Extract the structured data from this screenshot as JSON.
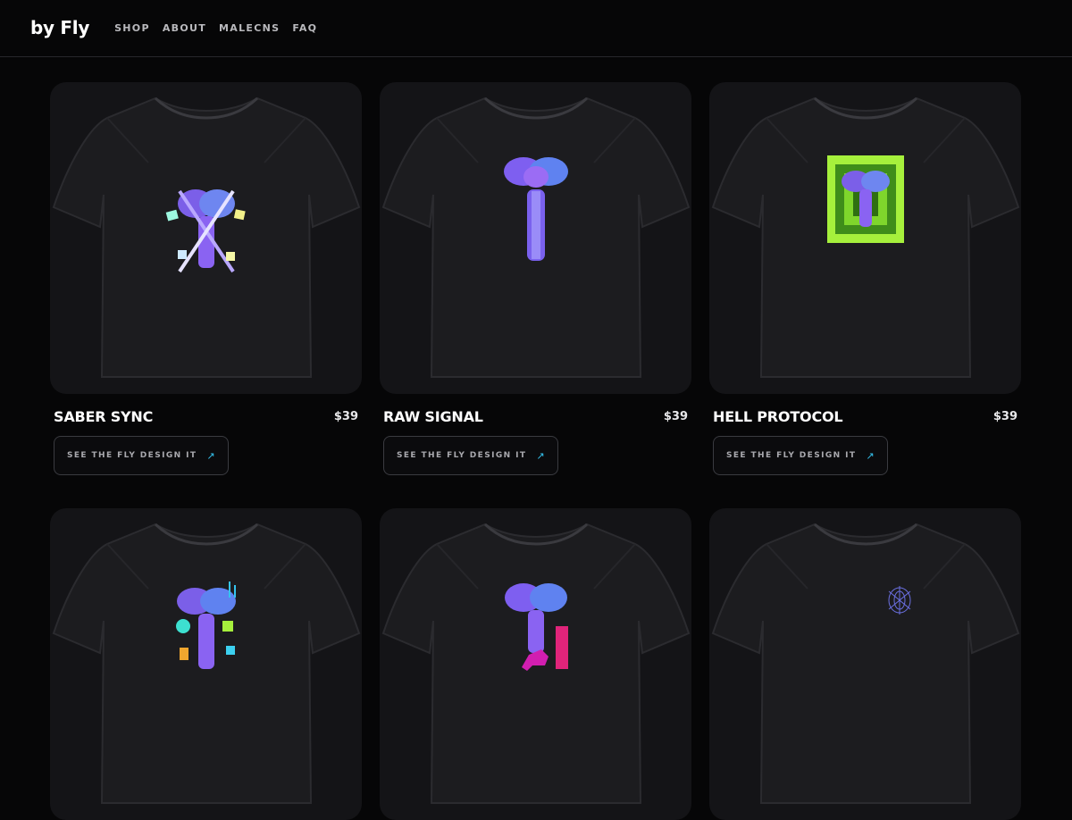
{
  "header": {
    "brand": "by Fly",
    "nav": [
      "SHOP",
      "ABOUT",
      "MALECNS",
      "FAQ"
    ]
  },
  "products": [
    {
      "name": "SABER SYNC",
      "price": "$39",
      "button": "SEE THE FLY DESIGN IT",
      "art": "brain-crossed-sabers"
    },
    {
      "name": "RAW SIGNAL",
      "price": "$39",
      "button": "SEE THE FLY DESIGN IT",
      "art": "brain-raw"
    },
    {
      "name": "HELL PROTOCOL",
      "price": "$39",
      "button": "SEE THE FLY DESIGN IT",
      "art": "brain-green-corridor"
    },
    {
      "name": "",
      "price": "",
      "button": "",
      "art": "brain-neon-circuits"
    },
    {
      "name": "",
      "price": "",
      "button": "",
      "art": "brain-pink-figure"
    },
    {
      "name": "",
      "price": "",
      "button": "",
      "art": "small-line-emblem"
    }
  ],
  "colors": {
    "background": "#060607",
    "card": "#141417",
    "arrow_accent": "#35c3ee",
    "art_purple": "#8a63f2",
    "art_blue": "#4f7bf0",
    "art_green": "#a6f03c",
    "art_pink": "#e0247a"
  }
}
